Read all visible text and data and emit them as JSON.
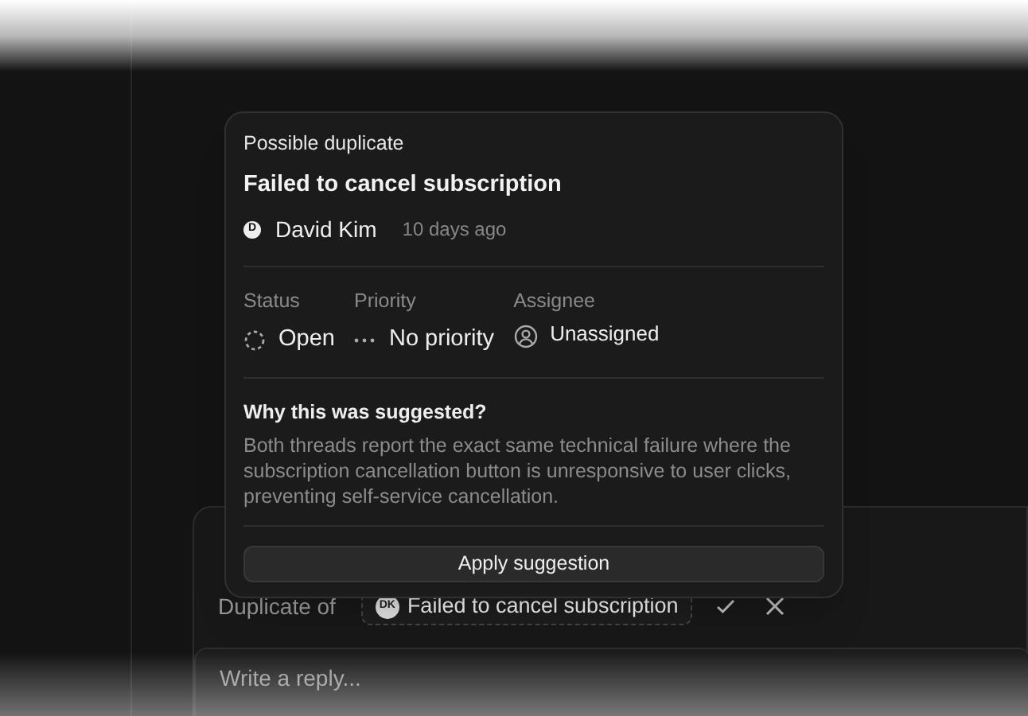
{
  "popover": {
    "label": "Possible duplicate",
    "title": "Failed to cancel subscription",
    "author": {
      "initial": "D",
      "name": "David Kim"
    },
    "time": "10 days ago",
    "fields": [
      {
        "kind": "status",
        "label": "Status",
        "value": "Open"
      },
      {
        "kind": "priority",
        "label": "Priority",
        "value": "No priority"
      },
      {
        "kind": "assignee",
        "label": "Assignee",
        "value": "Unassigned"
      }
    ],
    "reason_title": "Why this was suggested?",
    "reason": "Both threads report the exact same technical failure where the subscription cancellation button is unresponsive to user clicks, preventing self-service cancellation.",
    "button": "Apply suggestion"
  },
  "duplicate_row": {
    "label": "Duplicate of",
    "chip": {
      "initials": "DK",
      "title": "Failed to cancel subscription"
    }
  },
  "reply": {
    "placeholder": "Write a reply..."
  }
}
